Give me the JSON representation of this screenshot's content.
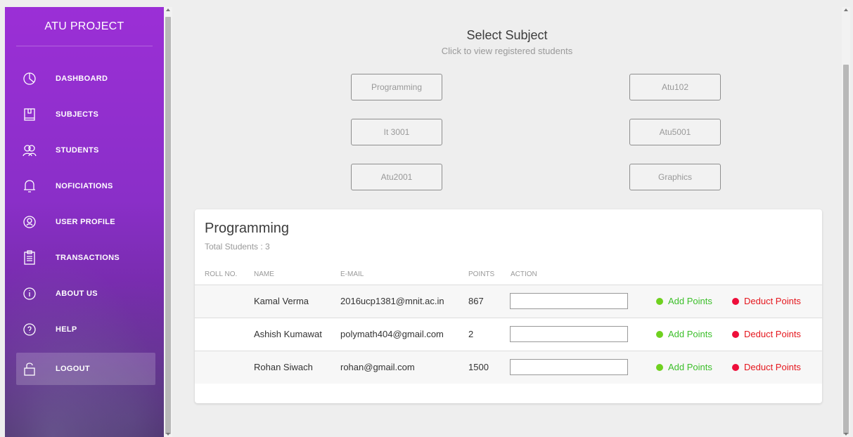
{
  "sidebar": {
    "brand": "ATU PROJECT",
    "items": [
      {
        "label": "DASHBOARD",
        "icon": "pie-chart-icon"
      },
      {
        "label": "SUBJECTS",
        "icon": "book-icon"
      },
      {
        "label": "STUDENTS",
        "icon": "users-icon"
      },
      {
        "label": "NOFICIATIONS",
        "icon": "bell-icon"
      },
      {
        "label": "USER PROFILE",
        "icon": "user-circle-icon"
      },
      {
        "label": "TRANSACTIONS",
        "icon": "clipboard-icon"
      },
      {
        "label": "ABOUT US",
        "icon": "info-icon"
      },
      {
        "label": "HELP",
        "icon": "help-icon"
      },
      {
        "label": "LOGOUT",
        "icon": "lock-icon",
        "active": true
      }
    ]
  },
  "main": {
    "title": "Select Subject",
    "subtitle": "Click to view registered students",
    "subjects": [
      "Programming",
      "Atu102",
      "It 3001",
      "Atu5001",
      "Atu2001",
      "Graphics"
    ]
  },
  "panel": {
    "title": "Programming",
    "total_label": "Total Students : 3",
    "columns": [
      "ROLL NO.",
      "NAME",
      "E-MAIL",
      "POINTS",
      "ACTION"
    ],
    "rows": [
      {
        "roll": "",
        "name": "Kamal Verma",
        "email": "2016ucp1381@mnit.ac.in",
        "points": "867"
      },
      {
        "roll": "",
        "name": "Ashish Kumawat",
        "email": "polymath404@gmail.com",
        "points": "2"
      },
      {
        "roll": "",
        "name": "Rohan Siwach",
        "email": "rohan@gmail.com",
        "points": "1500"
      }
    ],
    "add_label": "Add Points",
    "deduct_label": "Deduct Points",
    "colors": {
      "add": "#3cbf2a",
      "deduct": "#e5161d",
      "sidebar": "#9b2fd6"
    }
  }
}
